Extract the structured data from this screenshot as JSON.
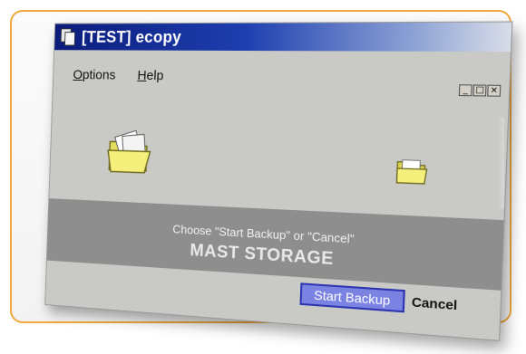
{
  "window": {
    "title": "[TEST] ecopy"
  },
  "title_controls": {
    "minimize": "_",
    "maximize": "□",
    "close": "×"
  },
  "menu": {
    "options_first": "O",
    "options_rest": "ptions",
    "help_first": "H",
    "help_rest": "elp"
  },
  "status": {
    "prompt": "Choose \"Start Backup\" or \"Cancel\"",
    "storage_name": "MAST STORAGE"
  },
  "buttons": {
    "start": "Start Backup",
    "cancel": "Cancel"
  },
  "colors": {
    "frame_border": "#f2a93b",
    "titlebar_start": "#0a1c7a",
    "band": "#8e8e8e",
    "start_button": "#7b83e2",
    "folder": "#f0eb7a"
  },
  "icons": {
    "source_folder": "open-folder-with-documents-icon",
    "destination_folder": "closed-folder-icon",
    "app": "copy-documents-icon"
  }
}
